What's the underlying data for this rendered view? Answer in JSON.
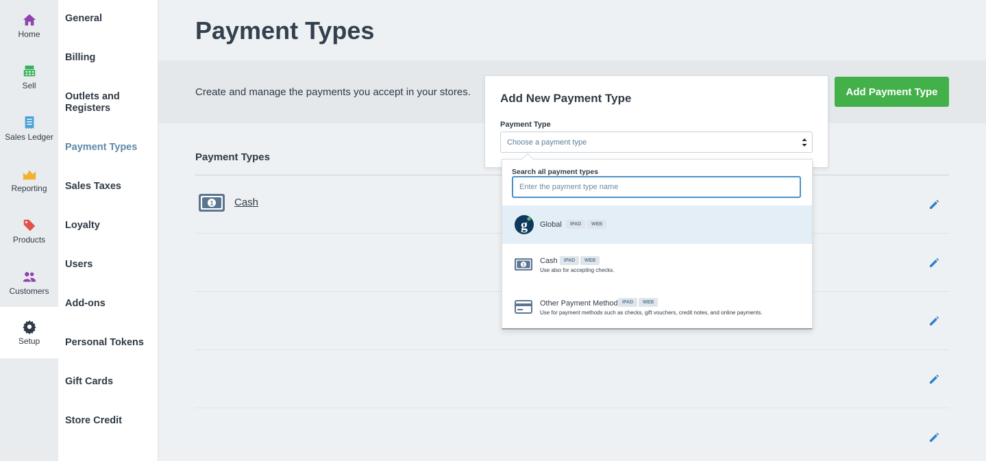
{
  "nav": {
    "items": [
      {
        "label": "Home",
        "icon": "home-icon",
        "color": "#8e44ad"
      },
      {
        "label": "Sell",
        "icon": "register-icon",
        "color": "#3bb15b"
      },
      {
        "label": "Sales Ledger",
        "icon": "receipt-icon",
        "color": "#4aa3d6"
      },
      {
        "label": "Reporting",
        "icon": "chart-icon",
        "color": "#f2b134"
      },
      {
        "label": "Products",
        "icon": "tag-icon",
        "color": "#e2524a"
      },
      {
        "label": "Customers",
        "icon": "people-icon",
        "color": "#8e44ad"
      },
      {
        "label": "Setup",
        "icon": "gear-icon",
        "color": "#2f3a45"
      }
    ]
  },
  "subnav": {
    "items": [
      {
        "label": "General"
      },
      {
        "label": "Billing"
      },
      {
        "label": "Outlets and Registers"
      },
      {
        "label": "Payment Types"
      },
      {
        "label": "Sales Taxes"
      },
      {
        "label": "Loyalty"
      },
      {
        "label": "Users"
      },
      {
        "label": "Add-ons"
      },
      {
        "label": "Personal Tokens"
      },
      {
        "label": "Gift Cards"
      },
      {
        "label": "Store Credit"
      }
    ]
  },
  "page": {
    "title": "Payment Types",
    "description": "Create and manage the payments you accept in your stores.",
    "add_button": "Add Payment Type",
    "list_title": "Payment Types",
    "rows": [
      {
        "name": "Cash"
      }
    ]
  },
  "modal": {
    "title": "Add New Payment Type",
    "field_label": "Payment Type",
    "select_placeholder": "Choose a payment type"
  },
  "dropdown": {
    "search_label": "Search all payment types",
    "search_placeholder": "Enter the payment type name",
    "options": [
      {
        "name": "Global",
        "badges": [
          "IPAD",
          "WEB"
        ],
        "description": ""
      },
      {
        "name": "Cash",
        "badges": [
          "IPAD",
          "WEB"
        ],
        "description": "Use also for accepting checks."
      },
      {
        "name": "Other Payment Method",
        "badges": [
          "IPAD",
          "WEB"
        ],
        "description": "Use for payment methods such as checks, gift vouchers, credit notes, and online payments."
      }
    ]
  },
  "colors": {
    "accent_green": "#43b049",
    "active_link": "#5b8aa8",
    "edit_icon": "#2f80c9",
    "focus_border": "#4a90c8"
  }
}
